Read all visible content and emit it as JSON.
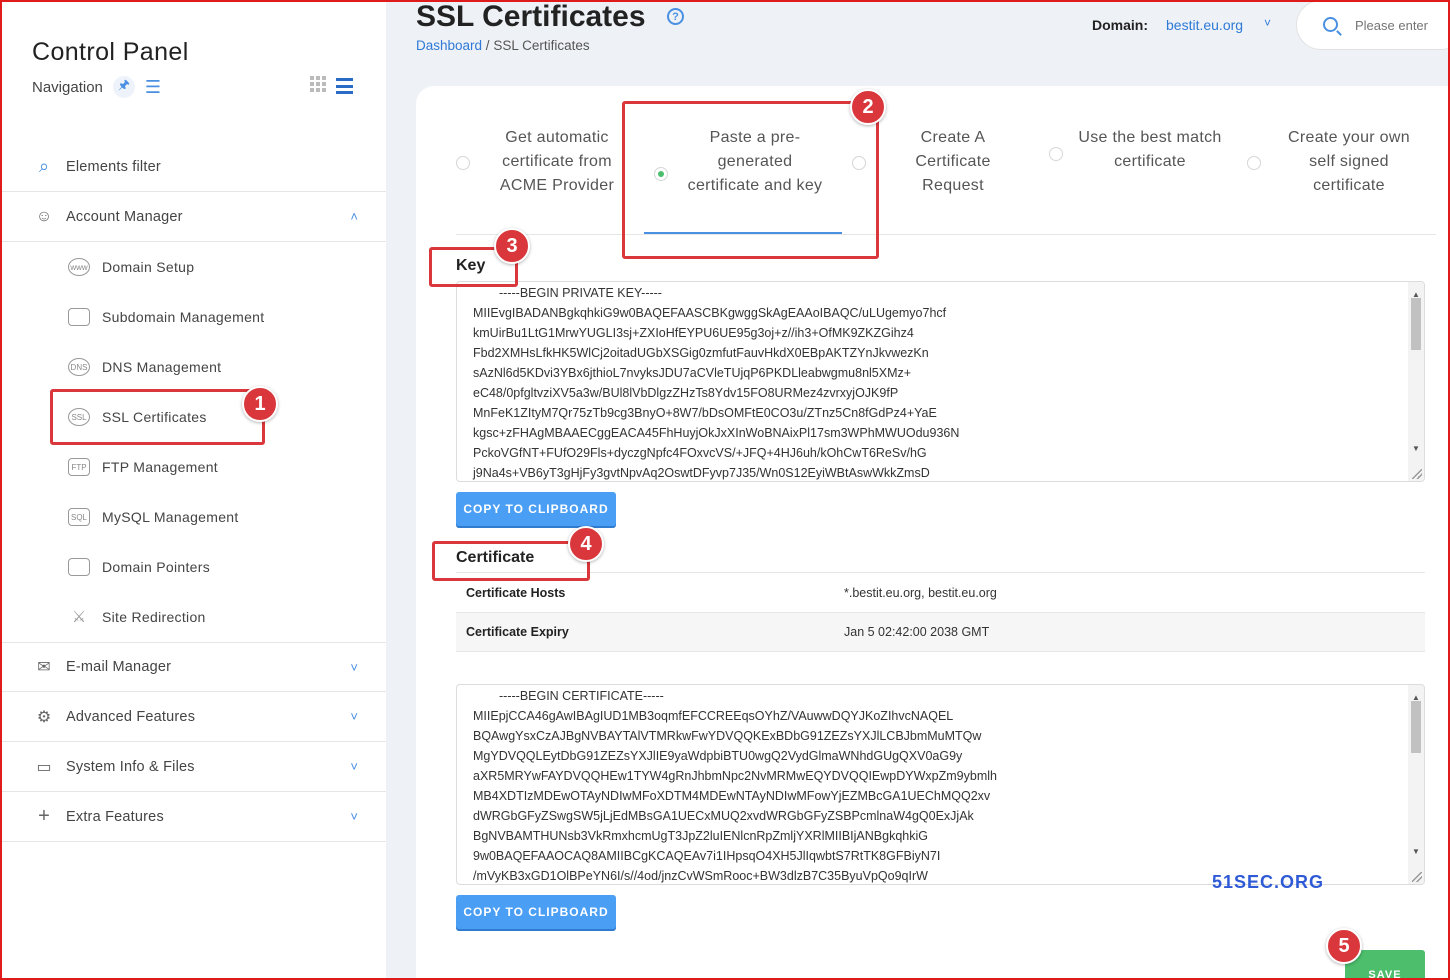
{
  "sidebar": {
    "title": "Control Panel",
    "nav_label": "Navigation",
    "filter_label": "Elements filter",
    "sections": [
      {
        "label": "Account Manager",
        "icon": "user-icon"
      },
      {
        "label": "E-mail Manager",
        "icon": "envelope-icon"
      },
      {
        "label": "Advanced Features",
        "icon": "gear-doc-icon"
      },
      {
        "label": "System Info & Files",
        "icon": "folder-icon"
      },
      {
        "label": "Extra Features",
        "icon": "plus-icon"
      }
    ],
    "subitems": [
      {
        "label": "Domain Setup",
        "icon": "www-icon"
      },
      {
        "label": "Subdomain Management",
        "icon": "monitor-icon"
      },
      {
        "label": "DNS Management",
        "icon": "dns-icon"
      },
      {
        "label": "SSL Certificates",
        "icon": "certificate-icon"
      },
      {
        "label": "FTP Management",
        "icon": "ftp-folder-icon"
      },
      {
        "label": "MySQL Management",
        "icon": "sql-icon"
      },
      {
        "label": "Domain Pointers",
        "icon": "monitor-icon"
      },
      {
        "label": "Site Redirection",
        "icon": "signpost-icon"
      }
    ]
  },
  "header": {
    "title": "SSL Certificates",
    "breadcrumb_home": "Dashboard",
    "breadcrumb_sep": " / ",
    "breadcrumb_current": "SSL Certificates",
    "domain_label": "Domain:",
    "domain_value": "bestit.eu.org",
    "search_placeholder": "Please enter"
  },
  "tabs": [
    {
      "label": "Get automatic certificate from ACME Provider",
      "selected": false
    },
    {
      "label": "Paste a pre-generated certificate and key",
      "selected": true
    },
    {
      "label": "Create A Certificate Request",
      "selected": false
    },
    {
      "label": "Use the best match certificate",
      "selected": false
    },
    {
      "label": "Create your own self signed certificate",
      "selected": false
    }
  ],
  "key_section": {
    "title": "Key",
    "lines": [
      "-----BEGIN PRIVATE KEY-----",
      "MIIEvgIBADANBgkqhkiG9w0BAQEFAASCBKgwggSkAgEAAoIBAQC/uLUgemyo7hcf",
      "kmUirBu1LtG1MrwYUGLI3sj+ZXIoHfEYPU6UE95g3oj+z//ih3+OfMK9ZKZGihz4",
      "Fbd2XMHsLfkHK5WlCj2oitadUGbXSGig0zmfutFauvHkdX0EBpAKTZYnJkvwezKn",
      "sAzNl6d5KDvi3YBx6jthioL7nvyksJDU7aCVleTUjqP6PKDLleabwgmu8nl5XMz+",
      "eC48/0pfgltvziXV5a3w/BUl8lVbDlgzZHzTs8Ydv15FO8URMez4zvrxyjOJK9fP",
      "MnFeK1ZItyM7Qr75zTb9cg3BnyO+8W7/bDsOMFtE0CO3u/ZTnz5Cn8fGdPz4+YaE",
      "kgsc+zFHAgMBAAECggEACA45FhHuyjOkJxXInWoBNAixPl17sm3WPhMWUOdu936N",
      "PckoVGfNT+FUfO29Fls+dyczgNpfc4FOxvcVS/+JFQ+4HJ6uh/kOhCwT6ReSv/hG",
      "j9Na4s+VB6yT3gHjFy3gvtNpvAq2OswtDFyvp7J35/Wn0S12EyiWBtAswWkkZmsD"
    ],
    "copy_label": "COPY TO CLIPBOARD"
  },
  "cert_section": {
    "title": "Certificate",
    "rows": [
      {
        "key": "Certificate Hosts",
        "value": "*.bestit.eu.org, bestit.eu.org"
      },
      {
        "key": "Certificate Expiry",
        "value": "Jan 5 02:42:00 2038 GMT"
      }
    ],
    "lines": [
      "-----BEGIN CERTIFICATE-----",
      "MIIEpjCCA46gAwIBAgIUD1MB3oqmfEFCCREEqsOYhZ/VAuwwDQYJKoZIhvcNAQEL",
      "BQAwgYsxCzAJBgNVBAYTAlVTMRkwFwYDVQQKExBDbG91ZEZsYXJlLCBJbmMuMTQw",
      "MgYDVQQLEytDbG91ZEZsYXJlIE9yaWdpbiBTU0wgQ2VydGlmaWNhdGUgQXV0aG9y",
      "aXR5MRYwFAYDVQQHEw1TYW4gRnJhbmNpc2NvMRMwEQYDVQQIEwpDYWxpZm9ybmlh",
      "MB4XDTIzMDEwOTAyNDIwMFoXDTM4MDEwNTAyNDIwMFowYjEZMBcGA1UEChMQQ2xv",
      "dWRGbGFyZSwgSW5jLjEdMBsGA1UECxMUQ2xvdWRGbGFyZSBPcmlnaW4gQ0ExJjAk",
      "BgNVBAMTHUNsb3VkRmxhcmUgT3JpZ2luIENlcnRpZmljYXRlMIIBIjANBgkqhkiG",
      "9w0BAQEFAAOCAQ8AMIIBCgKCAQEAv7i1IHpsqO4XH5JlIqwbtS7RtTK8GFBiyN7I",
      "/mVyKB3xGD1OlBPeYN6I/s//4od/jnzCvWSmRooc+BW3dlzB7C35ByuVpQo9qIrW"
    ],
    "copy_label": "COPY TO CLIPBOARD"
  },
  "watermark": "51SEC.ORG",
  "save_label": "SAVE",
  "annotations": [
    "1",
    "2",
    "3",
    "4",
    "5"
  ],
  "colors": {
    "accent": "#4a90e2",
    "annotation": "#d9373b",
    "save": "#4cbe6c",
    "watermark": "#2f5ad6"
  }
}
